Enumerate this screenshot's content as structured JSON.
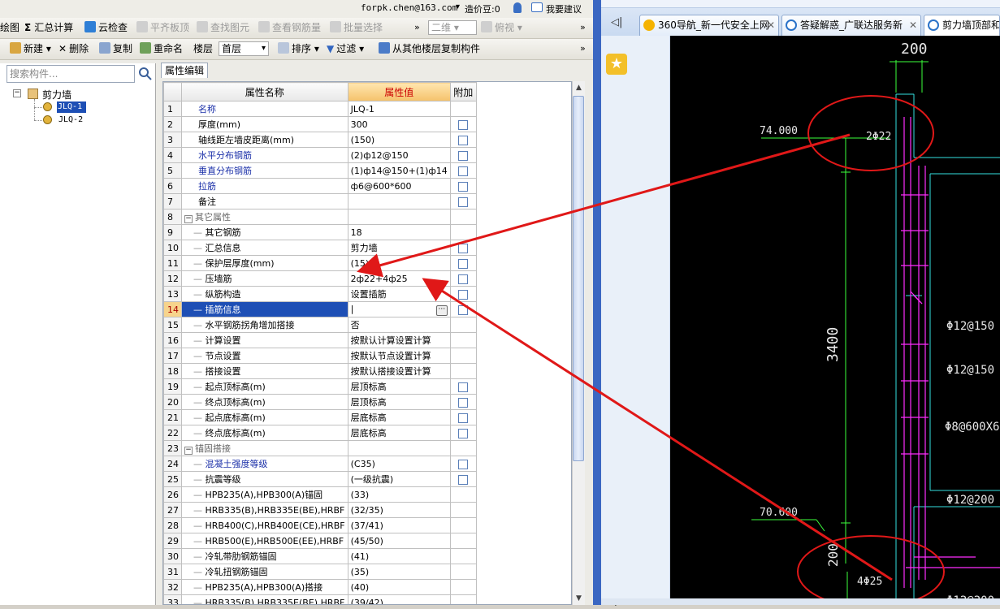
{
  "topbar": {
    "email": "forpk.chen@163.com",
    "cost": "造价豆:0",
    "suggest": "我要建议"
  },
  "toolbar1": {
    "draw": "绘图",
    "summary": "汇总计算",
    "cloud_check": "云检查",
    "flat_slab": "平齐板顶",
    "find_element": "查找图元",
    "view_rebar": "查看钢筋量",
    "batch_select": "批量选择",
    "view_2d": "二维",
    "view_top": "俯视"
  },
  "toolbar2": {
    "new": "新建",
    "delete": "删除",
    "copy": "复制",
    "rename": "重命名",
    "floor_label": "楼层",
    "floor_value": "首层",
    "sort": "排序",
    "filter": "过滤",
    "copy_from_floor": "从其他楼层复制构件"
  },
  "tree": {
    "search_placeholder": "搜索构件...",
    "root": "剪力墙",
    "items": [
      "JLQ-1",
      "JLQ-2"
    ]
  },
  "props": {
    "tab": "属性编辑",
    "headers": [
      "属性名称",
      "属性值",
      "附加"
    ],
    "rows": [
      {
        "n": "1",
        "name": "名称",
        "value": "JLQ-1",
        "blue": true,
        "cb": false
      },
      {
        "n": "2",
        "name": "厚度(mm)",
        "value": "300",
        "cb": true
      },
      {
        "n": "3",
        "name": "轴线距左墙皮距离(mm)",
        "value": "(150)",
        "cb": true
      },
      {
        "n": "4",
        "name": "水平分布钢筋",
        "value": "(2)ф12@150",
        "blue": true,
        "cb": true
      },
      {
        "n": "5",
        "name": "垂直分布钢筋",
        "value": "(1)ф14@150+(1)ф14",
        "blue": true,
        "cb": true
      },
      {
        "n": "6",
        "name": "拉筋",
        "value": "ф6@600*600",
        "blue": true,
        "cb": true
      },
      {
        "n": "7",
        "name": "备注",
        "value": "",
        "cb": true
      },
      {
        "n": "8",
        "name": "其它属性",
        "value": "",
        "group": true
      },
      {
        "n": "9",
        "name": "其它钢筋",
        "value": "18",
        "child": true
      },
      {
        "n": "10",
        "name": "汇总信息",
        "value": "剪力墙",
        "child": true,
        "cb": true
      },
      {
        "n": "11",
        "name": "保护层厚度(mm)",
        "value": "(15)",
        "child": true,
        "cb": true
      },
      {
        "n": "12",
        "name": "压墙筋",
        "value": "2ф22+4ф25",
        "child": true,
        "cb": true
      },
      {
        "n": "13",
        "name": "纵筋构造",
        "value": "设置插筋",
        "child": true,
        "cb": true
      },
      {
        "n": "14",
        "name": "插筋信息",
        "value": "",
        "child": true,
        "cb": true,
        "selected": true
      },
      {
        "n": "15",
        "name": "水平钢筋拐角增加搭接",
        "value": "否",
        "child": true
      },
      {
        "n": "16",
        "name": "计算设置",
        "value": "按默认计算设置计算",
        "child": true
      },
      {
        "n": "17",
        "name": "节点设置",
        "value": "按默认节点设置计算",
        "child": true
      },
      {
        "n": "18",
        "name": "搭接设置",
        "value": "按默认搭接设置计算",
        "child": true
      },
      {
        "n": "19",
        "name": "起点顶标高(m)",
        "value": "层顶标高",
        "child": true,
        "cb": true
      },
      {
        "n": "20",
        "name": "终点顶标高(m)",
        "value": "层顶标高",
        "child": true,
        "cb": true
      },
      {
        "n": "21",
        "name": "起点底标高(m)",
        "value": "层底标高",
        "child": true,
        "cb": true
      },
      {
        "n": "22",
        "name": "终点底标高(m)",
        "value": "层底标高",
        "child": true,
        "cb": true
      },
      {
        "n": "23",
        "name": "锚固搭接",
        "value": "",
        "group": true
      },
      {
        "n": "24",
        "name": "混凝土强度等级",
        "value": "(C35)",
        "child": true,
        "blue": true,
        "cb": true
      },
      {
        "n": "25",
        "name": "抗震等级",
        "value": "(一级抗震)",
        "child": true,
        "cb": true
      },
      {
        "n": "26",
        "name": "HPB235(A),HPB300(A)锚固",
        "value": "(33)",
        "child": true
      },
      {
        "n": "27",
        "name": "HRB335(B),HRB335E(BE),HRBF",
        "value": "(32/35)",
        "child": true
      },
      {
        "n": "28",
        "name": "HRB400(C),HRB400E(CE),HRBF",
        "value": "(37/41)",
        "child": true
      },
      {
        "n": "29",
        "name": "HRB500(E),HRB500E(EE),HRBF",
        "value": "(45/50)",
        "child": true
      },
      {
        "n": "30",
        "name": "冷轧带肋钢筋锚固",
        "value": "(41)",
        "child": true
      },
      {
        "n": "31",
        "name": "冷轧扭钢筋锚固",
        "value": "(35)",
        "child": true
      },
      {
        "n": "32",
        "name": "HPB235(A),HPB300(A)搭接",
        "value": "(40)",
        "child": true
      },
      {
        "n": "33",
        "name": "HRB335(B),HRB335E(BE),HRBF",
        "value": "(39/42)",
        "child": true
      }
    ]
  },
  "browser": {
    "tabs": [
      "360导航_新一代安全上网",
      "答疑解惑_广联达服务新",
      "剪力墙顶部和"
    ],
    "back_label": "◁|"
  },
  "cad": {
    "dim_top": "200",
    "elev_top": "74.000",
    "bar_top": "2Φ22",
    "dim_height": "3400",
    "h_bar1": "Φ12@150",
    "h_bar2": "Φ12@150",
    "tie": "Φ8@600X6",
    "elev_bottom": "70.600",
    "h_bar3": "Φ12@200",
    "dim_bottom": "200",
    "bar_bottom": "4Φ25",
    "h_bar4": "Φ12@200"
  }
}
